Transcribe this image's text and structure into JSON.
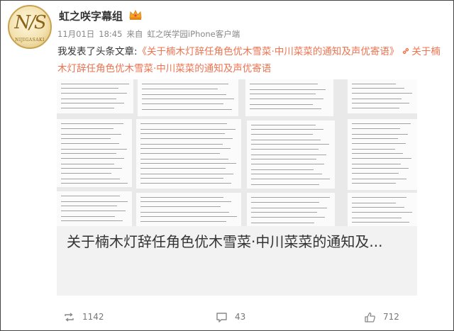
{
  "account": {
    "avatar_monogram": "N/S",
    "avatar_subtext": "NIJIGASAKI",
    "name": "虹之咲字幕组",
    "badge": "vip-crown-icon"
  },
  "meta": {
    "date": "11月01日",
    "time": "18:45",
    "source_prefix": "来自",
    "source": "虹之咲学园iPhone客户端"
  },
  "post": {
    "prefix": "我发表了头条文章:",
    "link_title": "《关于楠木灯辞任角色优木雪菜·中川菜菜的通知及声优寄语》",
    "link_icon": "link-icon",
    "link_repeat": "关于楠木灯辞任角色优木雪菜·中川菜菜的通知及声优寄语"
  },
  "card": {
    "title": "关于楠木灯辞任角色优木雪菜·中川菜菜的通知及..."
  },
  "actions": {
    "repost_count": "1142",
    "comment_count": "43",
    "like_count": "712"
  },
  "colors": {
    "link": "#eb7350",
    "text": "#333333",
    "muted": "#888888"
  }
}
